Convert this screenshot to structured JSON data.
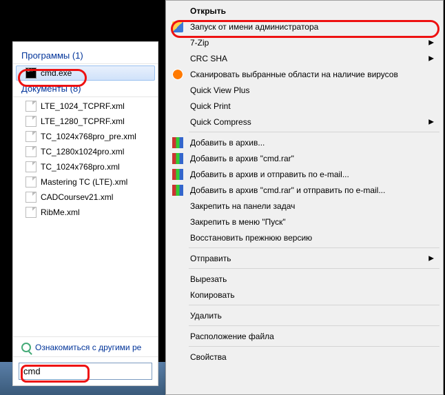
{
  "start": {
    "programs_label": "Программы",
    "programs_count": "(1)",
    "documents_label": "Документы",
    "documents_count": "(8)",
    "selected_program": "cmd.exe",
    "documents": [
      "LTE_1024_TCPRF.xml",
      "LTE_1280_TCPRF.xml",
      "TC_1024x768pro_pre.xml",
      "TC_1280x1024pro.xml",
      "TC_1024x768pro.xml",
      "Mastering TC (LTE).xml",
      "CADCoursev21.xml",
      "RibMe.xml"
    ],
    "see_more": "Ознакомиться с другими ре",
    "search_value": "cmd"
  },
  "menu": {
    "open": "Открыть",
    "run_as_admin": "Запуск от имени администратора",
    "seven_zip": "7-Zip",
    "crc_sha": "CRC SHA",
    "scan": "Сканировать выбранные области на наличие вирусов",
    "quick_view": "Quick View Plus",
    "quick_print": "Quick Print",
    "quick_compress": "Quick Compress",
    "add_archive": "Добавить в архив...",
    "add_cmd_rar": "Добавить в архив \"cmd.rar\"",
    "add_send_email": "Добавить в архив и отправить по e-mail...",
    "add_cmd_rar_email": "Добавить в архив \"cmd.rar\" и отправить по e-mail...",
    "pin_taskbar": "Закрепить на панели задач",
    "pin_start": "Закрепить в меню \"Пуск\"",
    "restore_prev": "Восстановить прежнюю версию",
    "send_to": "Отправить",
    "cut": "Вырезать",
    "copy": "Копировать",
    "delete": "Удалить",
    "file_location": "Расположение файла",
    "properties": "Свойства"
  }
}
